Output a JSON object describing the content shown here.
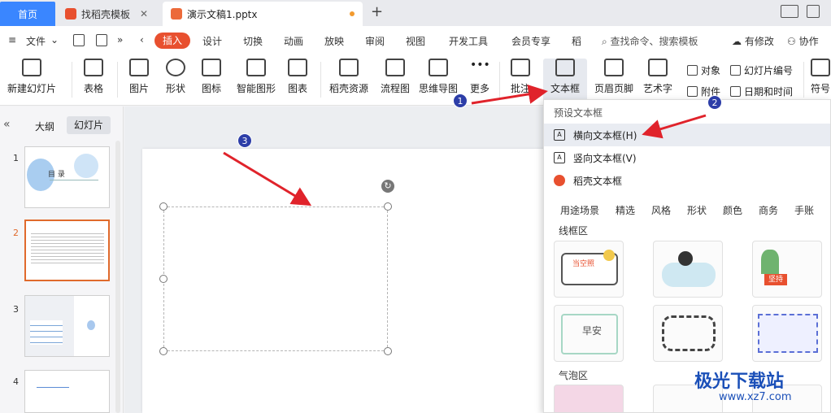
{
  "tabs": {
    "home": "首页",
    "template": "找稻壳模板",
    "document": "演示文稿1.pptx",
    "add": "+"
  },
  "menubar": {
    "file": "文件",
    "items": [
      "插入",
      "设计",
      "切换",
      "动画",
      "放映",
      "审阅",
      "视图",
      "开发工具",
      "会员专享",
      "稻"
    ],
    "search": "查找命令、搜索模板",
    "changes": "有修改",
    "collab": "协作"
  },
  "ribbon": {
    "new_slide": "新建幻灯片",
    "table": "表格",
    "picture": "图片",
    "shape": "形状",
    "icon": "图标",
    "smartart": "智能图形",
    "chart": "图表",
    "docer_resource": "稻壳资源",
    "flowchart": "流程图",
    "mindmap": "思维导图",
    "more": "更多",
    "comment": "批注",
    "textbox": "文本框",
    "header_footer": "页眉页脚",
    "wordart": "艺术字",
    "object": "对象",
    "attachment": "附件",
    "slide_number": "幻灯片编号",
    "datetime": "日期和时间",
    "symbol": "符号"
  },
  "left_panel": {
    "outline_tab": "大纲",
    "slides_tab": "幻灯片",
    "slide_numbers": [
      "1",
      "2",
      "3",
      "4"
    ],
    "thumb1_title": "目  录"
  },
  "dropdown": {
    "header": "预设文本框",
    "horizontal": "横向文本框(H)",
    "vertical": "竖向文本框(V)",
    "docer": "稻壳文本框",
    "categories": [
      "用途场景",
      "精选",
      "风格",
      "形状",
      "颜色",
      "商务",
      "手账"
    ],
    "section_border": "线框区",
    "section_bubble": "气泡区",
    "template_texts": [
      "当空照",
      "坚持",
      "早安"
    ]
  },
  "annotations": [
    "1",
    "2",
    "3"
  ],
  "watermark": {
    "brand": "极光下载站",
    "url": "www.xz7.com"
  },
  "colors": {
    "accent_blue": "#3a86ff",
    "insert_red": "#e8502f",
    "arrow_red": "#e0232b",
    "badge_blue": "#2d3ea8",
    "active_thumb": "#e06a2c"
  }
}
